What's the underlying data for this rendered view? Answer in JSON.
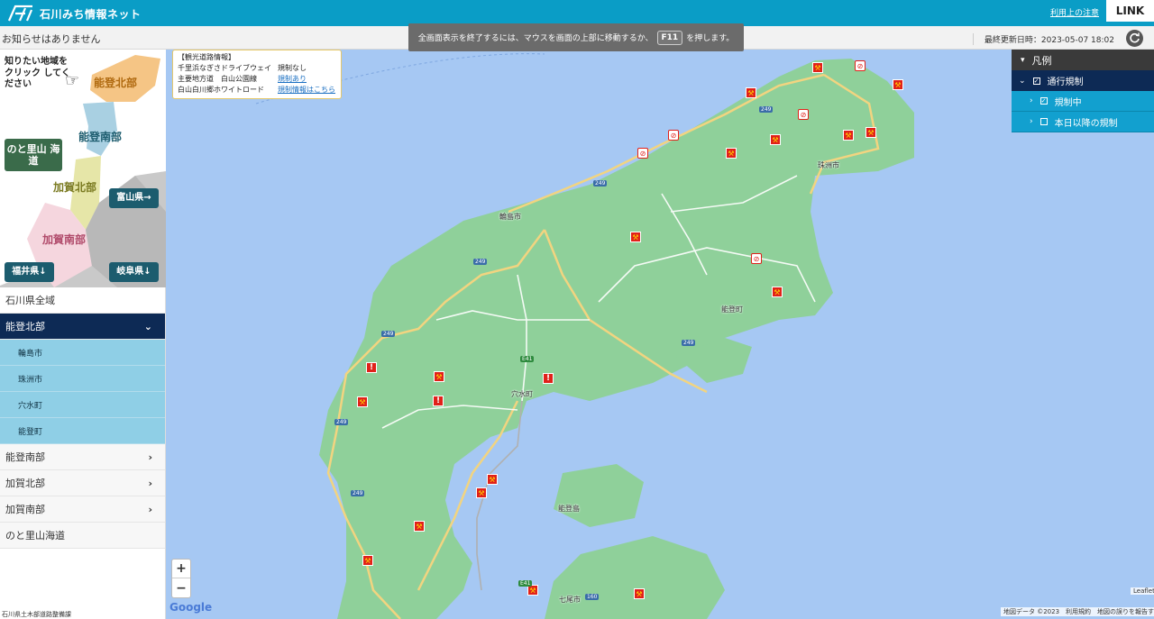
{
  "header": {
    "site_title": "石川みち情報ネット",
    "terms_link": "利用上の注意",
    "link_button": "LINK"
  },
  "notice": {
    "text": "お知らせはありません",
    "updated": "最終更新日時：2023-05-07 18:02"
  },
  "fullscreen_msg": {
    "before": "全画面表示を終了するには、マウスを画面の上部に移動するか、",
    "key": "F11",
    "after": "を押します。"
  },
  "region_map": {
    "prompt": "知りたい地域を クリック してください",
    "noto_north": "能登北部",
    "noto_south": "能登南部",
    "kaga_north": "加賀北部",
    "kaga_south": "加賀南部",
    "satoyama": "のと里山 海道",
    "toyama": "富山県→",
    "fukui": "福井県↓",
    "gifu": "岐阜県↓"
  },
  "nav": {
    "all": "石川県全域",
    "noto_north": "能登北部",
    "subs": [
      "輪島市",
      "珠洲市",
      "穴水町",
      "能登町"
    ],
    "noto_south": "能登南部",
    "kaga_north": "加賀北部",
    "kaga_south": "加賀南部",
    "satoyama": "のと里山海道"
  },
  "footer_credit": "石川県土木部道路整備課",
  "tour_info": {
    "title": "【観光道路情報】",
    "rows": [
      {
        "name": "千里浜なぎさドライブウェイ",
        "status": "規制なし"
      },
      {
        "name": "主要地方道　白山公園線",
        "status": "規制あり"
      },
      {
        "name": "白山白川郷ホワイトロード",
        "status": "規制情報はこちら"
      }
    ]
  },
  "legend": {
    "title": "凡例",
    "traffic": "通行規制",
    "current": "規制中",
    "future": "本日以降の規制"
  },
  "map": {
    "cities": [
      "輪島市",
      "珠洲市",
      "能登町",
      "穴水町",
      "能登島",
      "七尾市"
    ],
    "routes": [
      "249",
      "249",
      "249",
      "249",
      "249",
      "249",
      "249",
      "E41",
      "E41",
      "160"
    ],
    "zoom_in": "+",
    "zoom_out": "−",
    "google": "Google",
    "attribution": "地図データ ©2023　利用規約　地図の誤りを報告する",
    "leaflet": "Leaflet"
  },
  "colors": {
    "header": "#0a9dc6",
    "nav_active": "#0d2a55",
    "nav_sub": "#8fcfe6",
    "sea": "#a6c8f3",
    "land": "#8fd09a",
    "marker": "#e0211a"
  }
}
